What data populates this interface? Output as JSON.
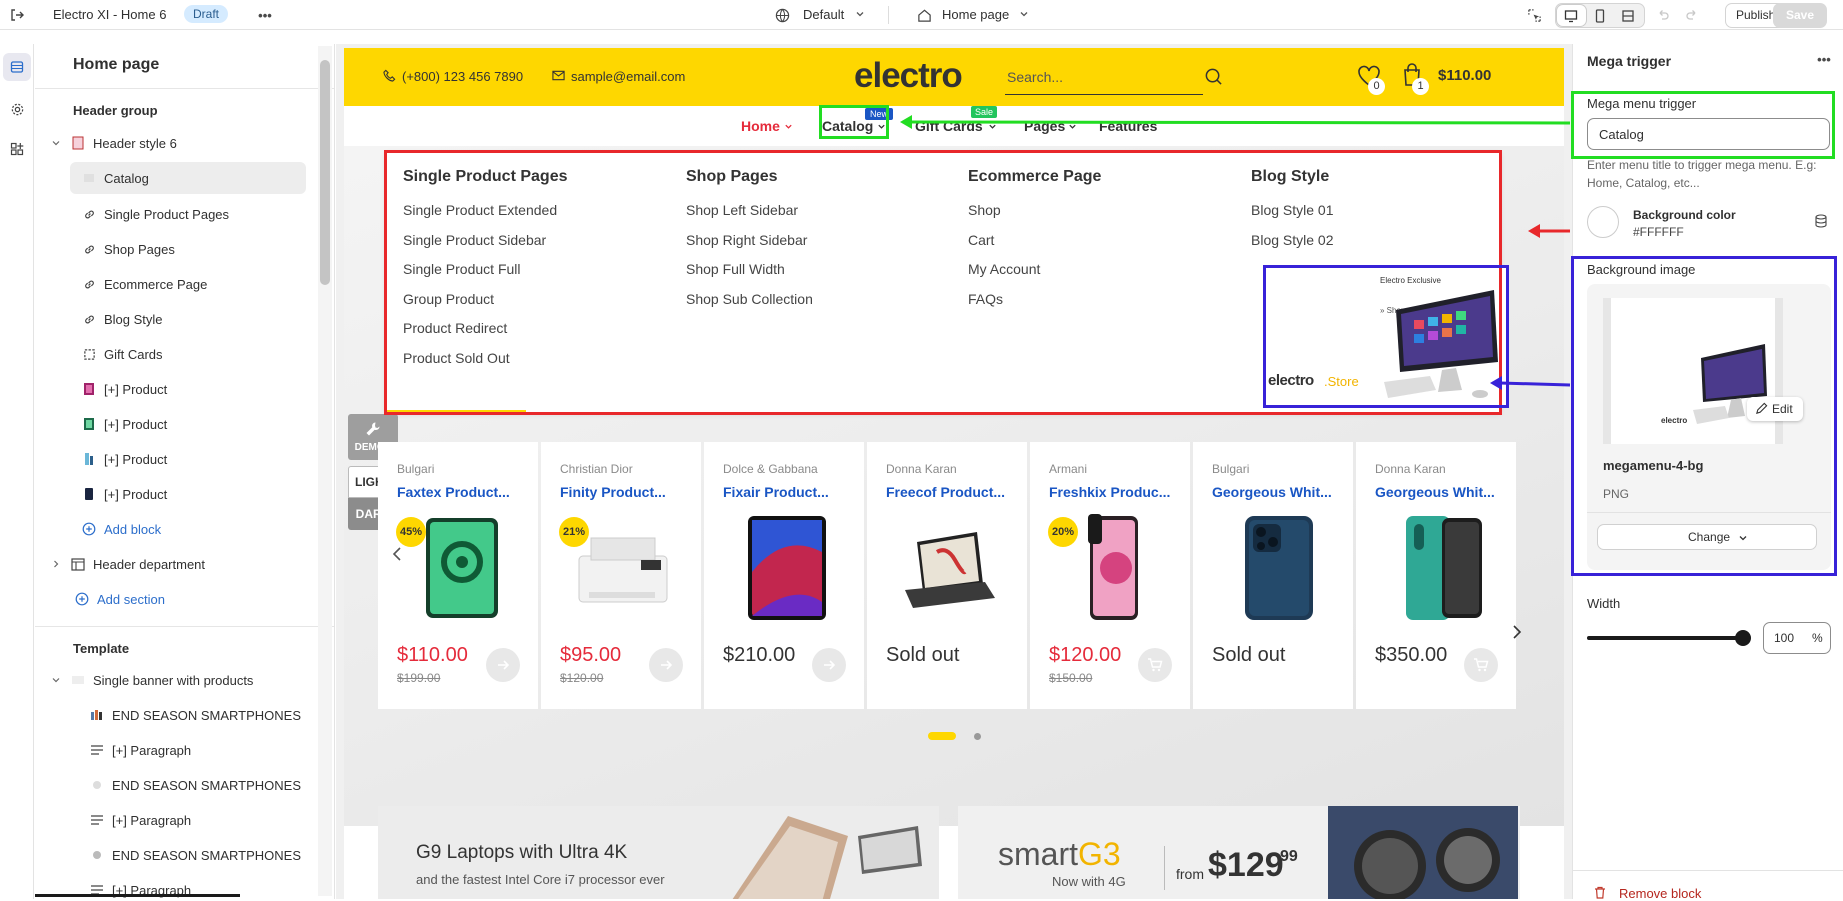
{
  "topbar": {
    "store_title": "Electro XI - Home 6",
    "status_badge": "Draft",
    "theme_select": "Default",
    "page_select": "Home page",
    "publish": "Publish",
    "save": "Save"
  },
  "left_panel": {
    "title": "Home page",
    "header_group_label": "Header group",
    "header_style": "Header style 6",
    "blocks": [
      "Catalog",
      "Single Product Pages",
      "Shop Pages",
      "Ecommerce Page",
      "Blog Style",
      "Gift Cards",
      "[+] Product",
      "[+] Product",
      "[+] Product",
      "[+] Product"
    ],
    "add_block": "Add block",
    "header_department": "Header department",
    "add_section": "Add section",
    "template_label": "Template",
    "single_banner": "Single banner with products",
    "template_items": [
      "END SEASON SMARTPHONES",
      "[+] Paragraph",
      "END SEASON SMARTPHONES",
      "[+] Paragraph",
      "END SEASON SMARTPHONES",
      "[+] Paragraph"
    ]
  },
  "storefront": {
    "phone": "(+800) 123 456 7890",
    "email": "sample@email.com",
    "logo": "electro",
    "search_placeholder": "Search...",
    "wishlist_count": "0",
    "cart_count": "1",
    "cart_total": "$110.00",
    "nav": [
      {
        "label": "Home",
        "active": true
      },
      {
        "label": "Catalog",
        "badge": "New"
      },
      {
        "label": "Gift Cards",
        "badge": "Sale"
      },
      {
        "label": "Pages"
      },
      {
        "label": "Features"
      }
    ],
    "mega_menu": {
      "columns": [
        {
          "title": "Single Product Pages",
          "items": [
            "Single Product Extended",
            "Single Product Sidebar",
            "Single Product Full",
            "Group Product",
            "Product Redirect",
            "Product Sold Out"
          ]
        },
        {
          "title": "Shop Pages",
          "items": [
            "Shop Left Sidebar",
            "Shop Right Sidebar",
            "Shop Full Width",
            "Shop Sub Collection"
          ]
        },
        {
          "title": "Ecommerce Page",
          "items": [
            "Shop",
            "Cart",
            "My Account",
            "FAQs"
          ]
        },
        {
          "title": "Blog Style",
          "items": [
            "Blog Style 01",
            "Blog Style 02"
          ]
        }
      ],
      "promo_tag": "Electro Exclusive",
      "promo_shop": "» Shop now",
      "promo_logo": "electro",
      "promo_logo_suffix": ".Store"
    },
    "side_tools": {
      "demos": "DEMOS",
      "light": "LIGHT",
      "dark": "DARK"
    },
    "products": [
      {
        "brand": "Bulgari",
        "name": "Faxtex Product...",
        "discount": "45%",
        "price": "$110.00",
        "old_price": "$199.00",
        "sale": true
      },
      {
        "brand": "Christian Dior",
        "name": "Finity Product...",
        "discount": "21%",
        "price": "$95.00",
        "old_price": "$120.00",
        "sale": true
      },
      {
        "brand": "Dolce & Gabbana",
        "name": "Fixair Product...",
        "discount": "",
        "price": "$210.00",
        "old_price": "",
        "sale": false
      },
      {
        "brand": "Donna Karan",
        "name": "Freecof Product...",
        "discount": "",
        "price": "Sold out",
        "old_price": "",
        "sale": false
      },
      {
        "brand": "Armani",
        "name": "Freshkix Produc...",
        "discount": "20%",
        "price": "$120.00",
        "old_price": "$150.00",
        "sale": true
      },
      {
        "brand": "Bulgari",
        "name": "Georgeous Whit...",
        "discount": "",
        "price": "Sold out",
        "old_price": "",
        "sale": false
      },
      {
        "brand": "Donna Karan",
        "name": "Georgeous Whit...",
        "discount": "",
        "price": "$350.00",
        "old_price": "",
        "sale": false
      }
    ],
    "banner1": {
      "title": "G9 Laptops with Ultra 4K",
      "subtitle": "and the fastest Intel Core i7 processor ever"
    },
    "banner2": {
      "brand": "smart",
      "brand_accent": "G3",
      "tagline": "Now with 4G",
      "from": "from",
      "price_main": "$129",
      "price_cents": "99"
    }
  },
  "right_panel": {
    "title": "Mega trigger",
    "trigger_label": "Mega menu trigger",
    "trigger_value": "Catalog",
    "help": "Enter menu title to trigger mega menu. E.g: Home, Catalog, etc...",
    "bg_color_label": "Background color",
    "bg_color_value": "#FFFFFF",
    "bg_image_label": "Background image",
    "edit": "Edit",
    "file_name": "megamenu-4-bg",
    "file_type": "PNG",
    "change": "Change",
    "width_label": "Width",
    "width_value": "100",
    "width_unit": "%",
    "width_slider": 1.0,
    "remove_block": "Remove block"
  },
  "colors": {
    "accent_yellow": "#fed700",
    "link_blue": "#1a56c4",
    "sale_red": "#e52b3b",
    "annot_green": "#22dd22",
    "annot_red": "#e8282b",
    "annot_blue": "#3822d8"
  }
}
